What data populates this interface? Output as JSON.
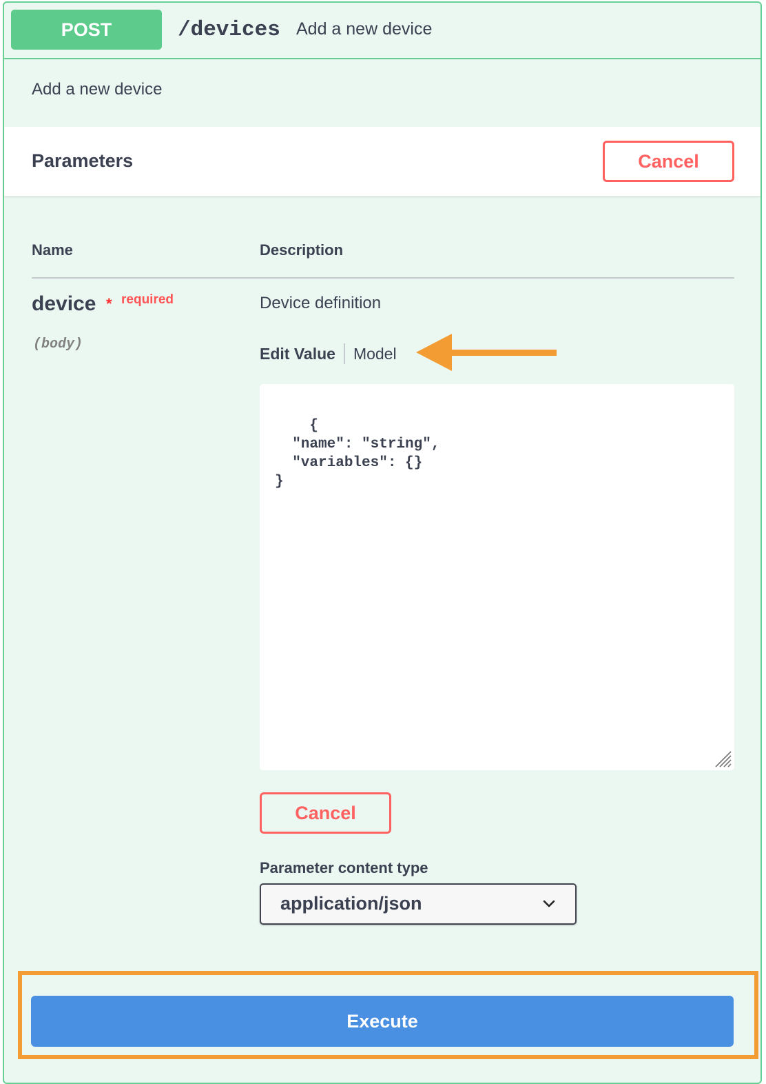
{
  "summary": {
    "method": "POST",
    "path": "/devices",
    "description": "Add a new device"
  },
  "description": "Add a new device",
  "parameters_section": {
    "title": "Parameters",
    "cancel_label": "Cancel"
  },
  "table": {
    "col_name": "Name",
    "col_description": "Description"
  },
  "param": {
    "name": "device",
    "required_star": "*",
    "required_label": "required",
    "location": "(body)",
    "description": "Device definition",
    "tab_edit": "Edit Value",
    "tab_model": "Model",
    "body_value": "{\n  \"name\": \"string\",\n  \"variables\": {}\n}",
    "cancel_label": "Cancel",
    "content_type_label": "Parameter content type",
    "content_type_value": "application/json"
  },
  "execute_label": "Execute",
  "colors": {
    "post_green": "#5dcb8c",
    "cancel_red": "#ff6060",
    "execute_blue": "#4990e2",
    "highlight_orange": "#f39c33"
  },
  "icons": [
    "left-arrow-annotation-icon",
    "resize-handle-icon",
    "chevron-down-icon"
  ]
}
